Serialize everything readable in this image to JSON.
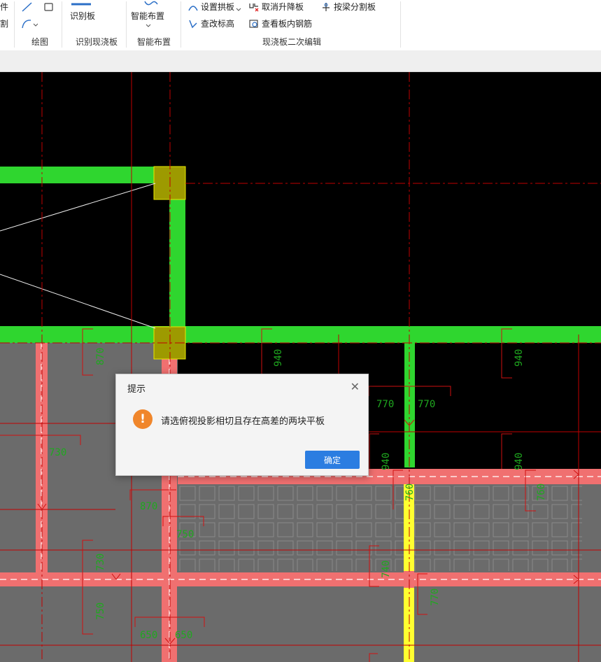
{
  "ribbon": {
    "left_top_fragment": "件",
    "left_bottom_fragment": "割",
    "draw_group": {
      "label": "绘图"
    },
    "identify_group": {
      "button": "识别板",
      "label": "识别现浇板"
    },
    "smart_group": {
      "button": "智能布置",
      "label": "智能布置"
    },
    "edit_group": {
      "label": "现浇板二次编辑",
      "items": [
        "设置拱板",
        "取消升降板",
        "按梁分割板",
        "查改标高",
        "查看板内钢筋"
      ]
    }
  },
  "canvas": {
    "dims": {
      "d940a": "940",
      "d870a": "870",
      "d770a": "770",
      "d770b": "770",
      "d730": "730",
      "d940b": "940",
      "d940c": "940",
      "d940d": "940",
      "d870b": "870",
      "d760a": "760",
      "d750": "750",
      "d760b": "760",
      "d730b": "730",
      "d740": "740",
      "d770c": "770",
      "d750b": "750",
      "d650a": "650",
      "d650b": "650"
    }
  },
  "dialog": {
    "title": "提示",
    "message": "请选俯视投影相切且存在高差的两块平板",
    "ok_label": "确定"
  },
  "colors": {
    "beam_green": "#2fd62f",
    "beam_red": "#f07070",
    "slab_gray": "#6b6b6b",
    "highlight_yellow": "#9d9a00",
    "axis_red": "#c00000",
    "dim_green": "#1fa81f",
    "ok_blue": "#2b7de1",
    "warn_orange": "#f0862b"
  }
}
